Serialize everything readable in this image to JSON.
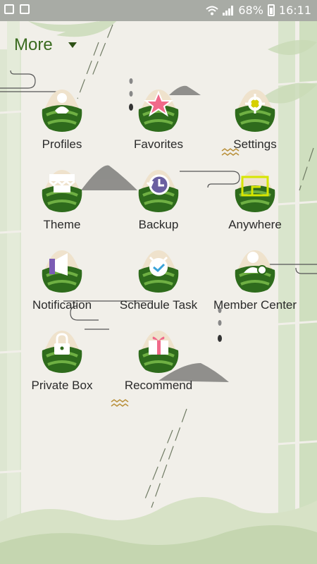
{
  "status_bar": {
    "battery": "68%",
    "time": "16:11"
  },
  "header": {
    "title": "More"
  },
  "items": [
    {
      "label": "Profiles",
      "icon": "person-icon"
    },
    {
      "label": "Favorites",
      "icon": "star-icon"
    },
    {
      "label": "Settings",
      "icon": "gear-icon"
    },
    {
      "label": "Theme",
      "icon": "shop-icon"
    },
    {
      "label": "Backup",
      "icon": "backup-clock-icon"
    },
    {
      "label": "Anywhere",
      "icon": "window-icon"
    },
    {
      "label": "Notification",
      "icon": "megaphone-icon"
    },
    {
      "label": "Schedule Task",
      "icon": "check-icon"
    },
    {
      "label": "Member Center",
      "icon": "member-icon"
    },
    {
      "label": "Private Box",
      "icon": "lock-icon"
    },
    {
      "label": "Recommend",
      "icon": "gift-icon"
    }
  ],
  "colors": {
    "leaf_dark": "#2e6b1c",
    "leaf_light": "#5ea33a",
    "rice": "#efe2cc",
    "text": "#2a2a2a",
    "accent": "#3a6b1f"
  }
}
